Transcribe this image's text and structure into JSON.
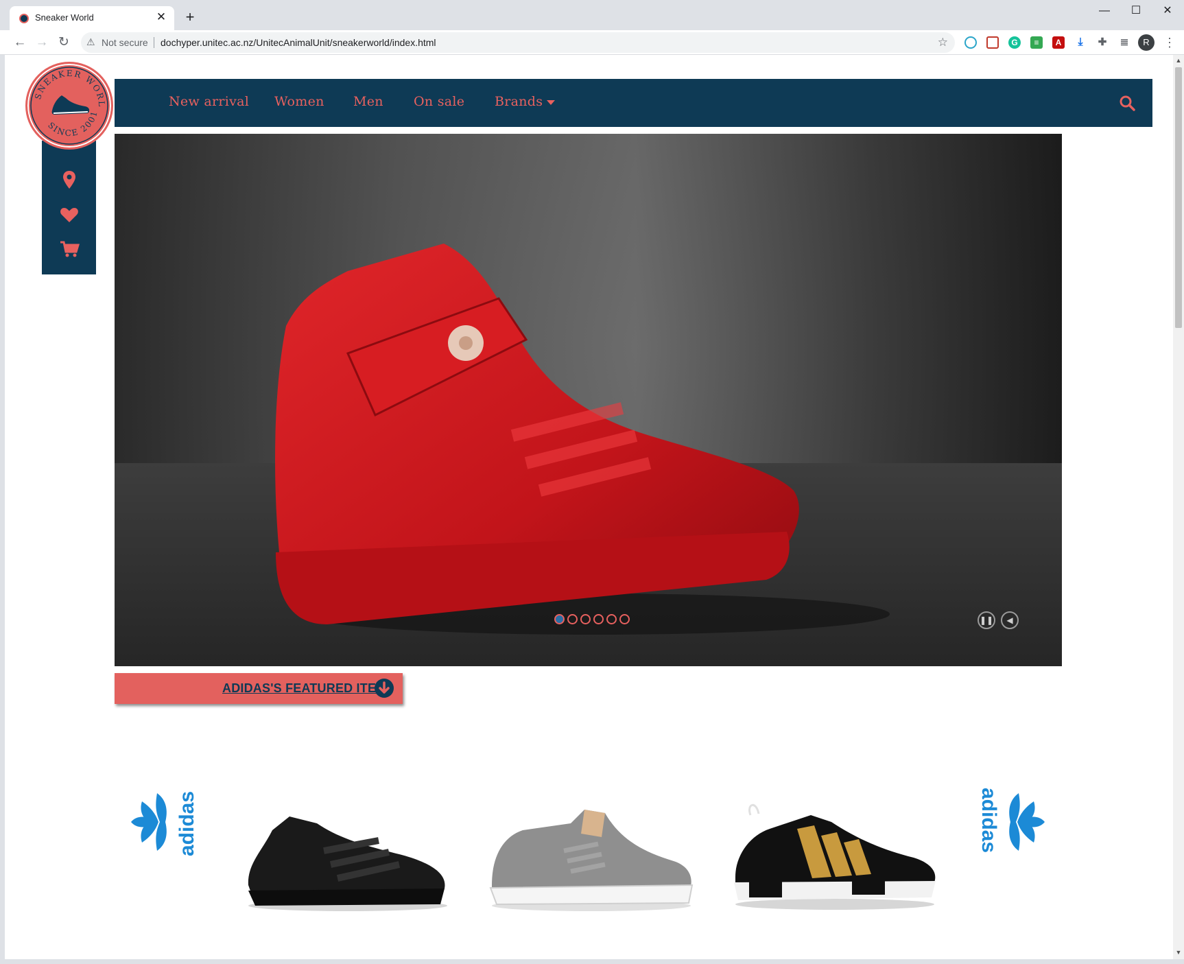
{
  "browser": {
    "tab_title": "Sneaker World",
    "tab_close": "✕",
    "new_tab": "+",
    "window_controls": [
      "—",
      "☐",
      "✕"
    ],
    "security_label": "Not secure",
    "url": "dochyper.unitec.ac.nz/UnitecAnimalUnit/sneakerworld/index.html",
    "profile_initial": "R"
  },
  "site": {
    "logo_text_top": "SNEAKER WORLD",
    "logo_text_bottom": "SINCE 2001",
    "nav": {
      "items": [
        "New arrival",
        "Women",
        "Men",
        "On sale",
        "Brands"
      ]
    },
    "side_icons": [
      "location-icon",
      "heart-icon",
      "cart-icon"
    ],
    "hero": {
      "slide_count": 6,
      "active_slide": 1
    },
    "featured": {
      "label": "ADIDAS'S FEATURED ITEM"
    },
    "products": [
      {
        "name": "black-adidas-runner",
        "color": "#1a1a1a"
      },
      {
        "name": "grey-adidas-skate",
        "color": "#8f8f8f"
      },
      {
        "name": "black-gold-adidas-nmd",
        "color": "#111111"
      }
    ],
    "brand_wordmark": "adidas",
    "colors": {
      "navy": "#0e3a55",
      "coral": "#e3615e",
      "adidas_blue": "#1c8ad6"
    }
  }
}
